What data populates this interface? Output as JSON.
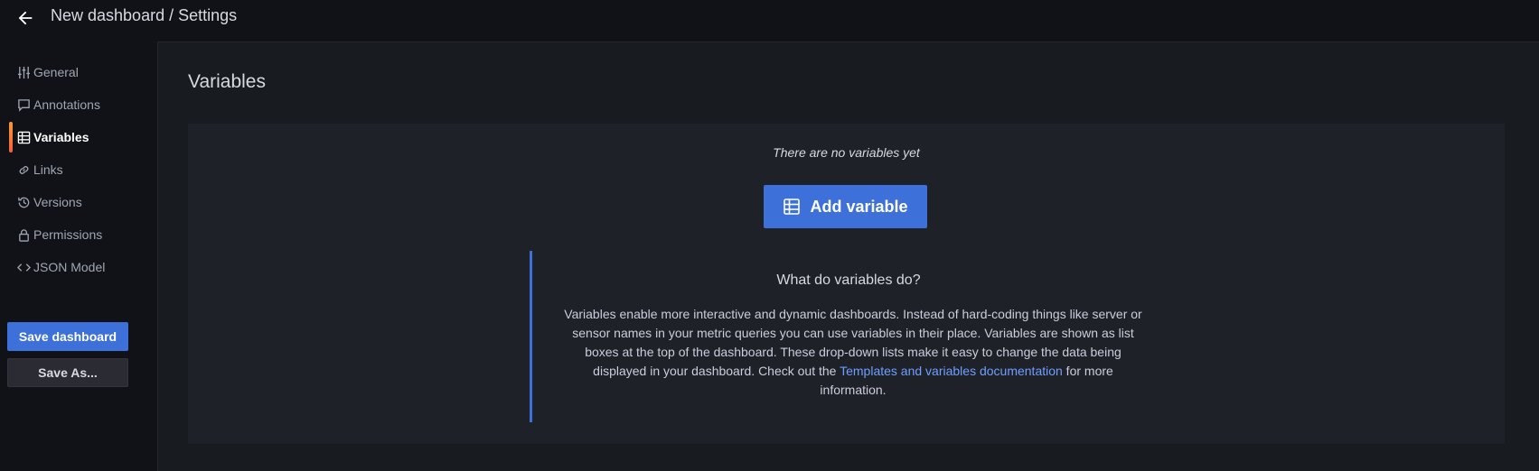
{
  "header": {
    "title": "New dashboard / Settings",
    "back_icon": "arrow-left-icon"
  },
  "sidebar": {
    "items": [
      {
        "label": "General",
        "icon": "sliders-icon",
        "active": false
      },
      {
        "label": "Annotations",
        "icon": "comment-icon",
        "active": false
      },
      {
        "label": "Variables",
        "icon": "table-icon",
        "active": true
      },
      {
        "label": "Links",
        "icon": "link-icon",
        "active": false
      },
      {
        "label": "Versions",
        "icon": "history-icon",
        "active": false
      },
      {
        "label": "Permissions",
        "icon": "lock-icon",
        "active": false
      },
      {
        "label": "JSON Model",
        "icon": "code-icon",
        "active": false
      }
    ],
    "save_label": "Save dashboard",
    "save_as_label": "Save As..."
  },
  "main": {
    "title": "Variables",
    "empty_text": "There are no variables yet",
    "add_button_label": "Add variable",
    "help": {
      "title": "What do variables do?",
      "text_before": "Variables enable more interactive and dynamic dashboards. Instead of hard-coding things like server or sensor names in your metric queries you can use variables in their place. Variables are shown as list boxes at the top of the dashboard. These drop-down lists make it easy to change the data being displayed in your dashboard. Check out the ",
      "link_text": "Templates and variables documentation",
      "text_after": " for more information."
    }
  },
  "colors": {
    "accent": "#3d71d9",
    "link": "#6e9fff",
    "active_indicator": "#ff9830"
  }
}
